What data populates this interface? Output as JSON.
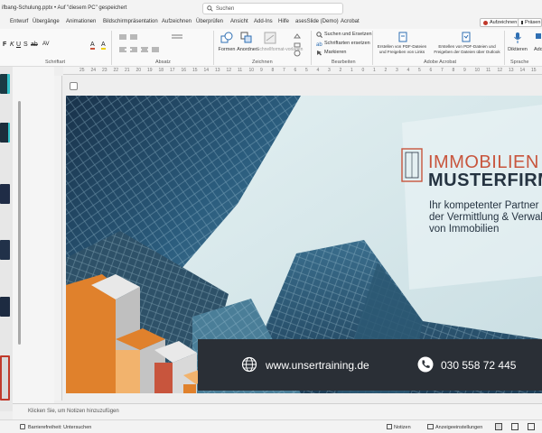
{
  "window": {
    "doc_title": "ifbang-Schulung.pptx • Auf \"diesem PC\" gespeichert",
    "search_placeholder": "Suchen"
  },
  "menu": {
    "tabs": [
      "Entwurf",
      "Übergänge",
      "Animationen",
      "Bildschirmpräsentation",
      "Aufzeichnen",
      "Überprüfen",
      "Ansicht",
      "Add-Ins",
      "Hilfe",
      "asesSlide (Demo)",
      "Acrobat"
    ],
    "record_label": "Aufzeichnen",
    "present_label": "Präsen"
  },
  "ribbon": {
    "groups": {
      "schrift": "Schriftart",
      "absatz": "Absatz",
      "zeichnen": "Zeichnen",
      "bearbeiten": "Bearbeiten",
      "acrobat": "Adobe Acrobat",
      "sprache": "Sprache",
      "addins": "Add-Ins"
    },
    "buttons": {
      "formen": "Formen",
      "anordnen": "Anordnen",
      "schnellformat": "Schnellformat-vorlagen",
      "suchen_ersetzen": "Suchen und Ersetzen",
      "schriftarten_ersetzen": "Schriftarten ersetzen",
      "markieren": "Markieren",
      "pdf_links": "Erstellen von PDF-Dateien und Freigeben von Links",
      "pdf_outlook": "Erstellen von PDF-Dateien und Freigeben der Dateien über Outlook",
      "diktieren": "Diktieren",
      "addins": "Add-Ins"
    }
  },
  "ruler": {
    "ticks": [
      "25",
      "24",
      "23",
      "22",
      "21",
      "20",
      "19",
      "18",
      "17",
      "16",
      "15",
      "14",
      "13",
      "12",
      "11",
      "10",
      "9",
      "8",
      "7",
      "6",
      "5",
      "4",
      "3",
      "2",
      "1",
      "0",
      "1",
      "2",
      "3",
      "4",
      "5",
      "6",
      "7",
      "8",
      "9",
      "10",
      "11",
      "12",
      "13",
      "14",
      "15"
    ]
  },
  "slide": {
    "brand_line1": "IMMOBILIEN",
    "brand_line2": "MUSTERFIRM",
    "tagline": [
      "Ihr kompetenter Partner b",
      "der Vermittlung & Verwalt",
      "von Immobilien"
    ],
    "website": "www.unsertraining.de",
    "phone": "030 558 72 445",
    "colors": {
      "accent_orange": "#e0812c",
      "accent_red": "#c8553d",
      "dark_navy": "#253341",
      "footer_bg": "#2a2f36"
    }
  },
  "notes": {
    "placeholder": "Klicken Sie, um Notizen hinzuzufügen"
  },
  "status": {
    "accessibility": "Barrierefreiheit: Untersuchen",
    "notes_btn": "Notizen",
    "display_settings": "Anzeigeeinstellungen"
  }
}
